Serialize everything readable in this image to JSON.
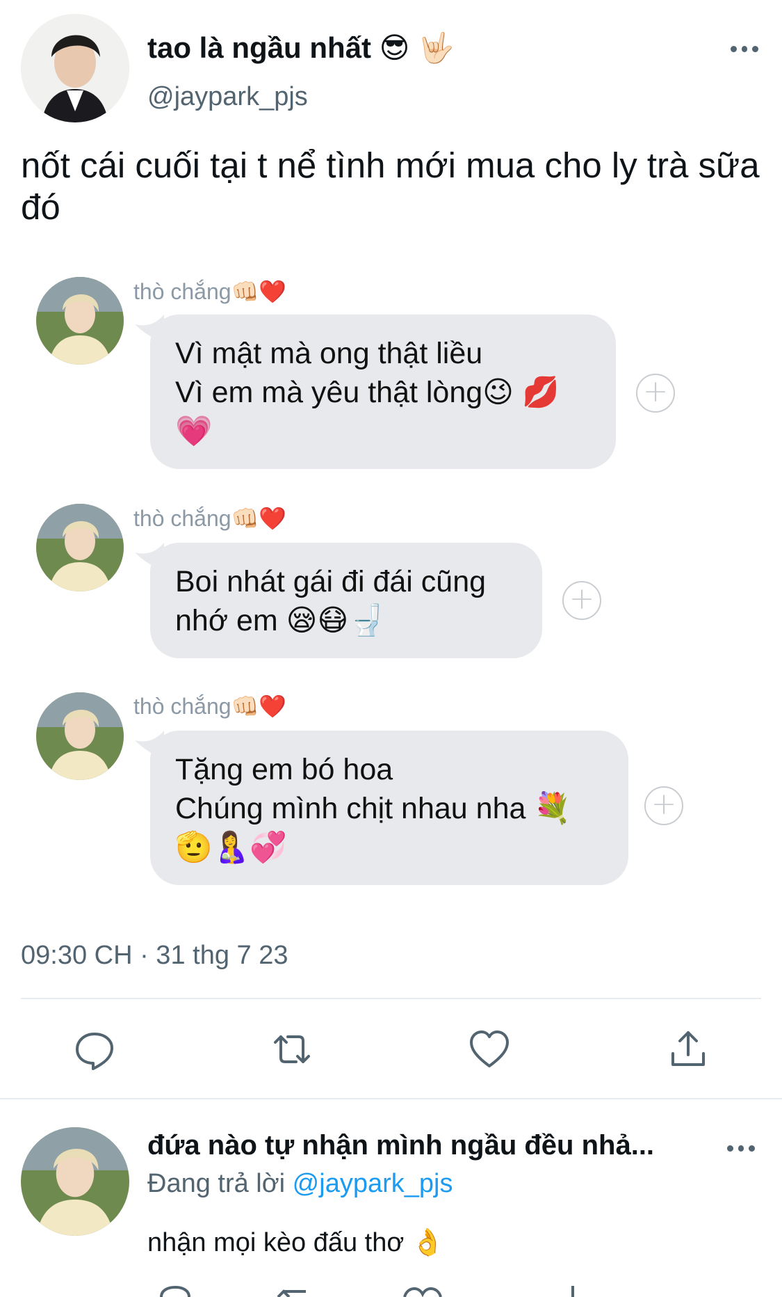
{
  "tweet": {
    "display_name": "tao là ngầu nhất 😎 🤟🏻",
    "handle": "@jaypark_pjs",
    "text": "nốt cái cuối tại t nể tình mới mua cho ly trà sữa đó",
    "timestamp": "09:30 CH · 31 thg 7 23"
  },
  "messages": [
    {
      "sender": "thò chắng👊🏻❤️",
      "line1": "Vì mật mà ong thật liều",
      "line2": "Vì em mà yêu thật lòng😉 💋",
      "line3": "💗"
    },
    {
      "sender": "thò chắng👊🏻❤️",
      "line1": "Boi nhát gái đi đái cũng",
      "line2": "nhớ em 😪😷🚽"
    },
    {
      "sender": "thò chắng👊🏻❤️",
      "line1": "Tặng em bó hoa",
      "line2": "Chúng mình chịt nhau nha 💐",
      "line3": "🫡🤱💞"
    }
  ],
  "actions": [
    "reply-icon",
    "retweet-icon",
    "like-icon",
    "share-icon"
  ],
  "reply": {
    "display_name": "đứa nào tự nhận mình ngầu đều nhả...",
    "replying_prefix": "Đang trả lời",
    "replying_handle": "@jaypark_pjs",
    "text": "nhận mọi kèo đấu thơ 👌"
  },
  "colors": {
    "link": "#1d9bf0",
    "secondary_text": "#536471",
    "bubble": "#e8e9ec"
  }
}
